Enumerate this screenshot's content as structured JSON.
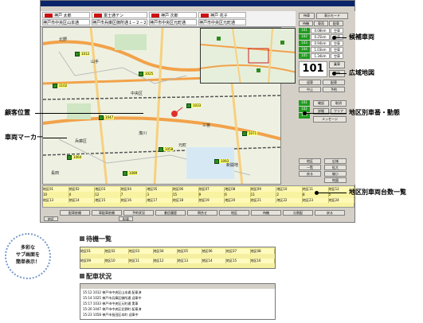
{
  "main_window": {
    "title_bar": "",
    "header": {
      "r1c1": "神戸 太郎",
      "r1c2": "富士通テン",
      "r1c3": "神戸 次郎",
      "r1c4": "神戸 花子",
      "r2c1": "神戸市中央区山本通",
      "r2c2": "神戸市兵庫区御所通１−２−２８",
      "r2c3": "神戸市中央区元町通",
      "r2c4": "神戸市中央区元町通"
    },
    "map_labels": [
      "北野",
      "中央区",
      "兵庫区",
      "湊川",
      "三宮",
      "元町",
      "長田",
      "新開地",
      "山手"
    ],
    "vehicle_labels": [
      "1012",
      "1025",
      "1033",
      "1047",
      "1058",
      "1064",
      "1071",
      "1089",
      "1093",
      "1102"
    ],
    "right_panel": {
      "top_buttons": [
        "待車",
        "表示モード"
      ],
      "tabs": [
        "待機",
        "車両",
        "配車"
      ],
      "rows": [
        {
          "no": "101",
          "time": "0.08km",
          "st": "空車"
        },
        {
          "no": "102",
          "time": "0.25km",
          "st": "空車"
        },
        {
          "no": "103",
          "time": "0.94km",
          "st": "空車"
        },
        {
          "no": "104",
          "time": "1.03km",
          "st": "空車"
        },
        {
          "no": "105",
          "time": "1.34km",
          "st": "空車"
        }
      ],
      "big_number": "101",
      "side_labels": [
        "乗車",
        "中央"
      ],
      "buttons": [
        "迎車",
        "配車",
        "中止",
        "予約",
        "確認",
        "取消",
        "詳細",
        "クリア",
        "メッセージ"
      ],
      "area_cars": [
        "101",
        "102",
        "103"
      ],
      "lower_buttons": [
        "広域",
        "拡大",
        "縮小",
        "地図",
        "他区",
        "一覧",
        "戻る"
      ]
    },
    "area_table": {
      "row1": [
        "地区01",
        "地区02",
        "地区03",
        "地区04",
        "地区05",
        "地区06",
        "地区07",
        "地区08",
        "地区09",
        "地区10",
        "地区11",
        "地区12"
      ],
      "row2": [
        "10",
        "4",
        "12",
        "7",
        "3",
        "15",
        "9",
        "6",
        "11",
        "2",
        "8",
        "5"
      ],
      "row3": [
        "地区13",
        "地区14",
        "地区15",
        "地区16",
        "地区17",
        "地区18",
        "地区19",
        "地区20",
        "地区21",
        "地区22",
        "地区23",
        "地区24"
      ]
    },
    "bottom_buttons": [
      "配車依頼",
      "車配車依頼",
      "予約状況",
      "着信履歴",
      "問合せ",
      "地区",
      "待機",
      "分割配",
      "戻る"
    ],
    "bottom_small": [
      "地区",
      "配車"
    ]
  },
  "callouts": {
    "candidate": "候補車両",
    "wide_map": "広域地図",
    "customer": "顧客位置",
    "area_vehicles": "地区別車番・動態",
    "vehicle_marker": "車両マーカー",
    "area_counts": "地区別車両台数一覧"
  },
  "bubble": {
    "line1": "多彩な",
    "line2": "サブ画面を",
    "line3": "簡単表示！"
  },
  "wait_section": {
    "title": "待機一覧",
    "row1": [
      "地区01",
      "地区02",
      "地区03",
      "地区04",
      "地区05",
      "地区06",
      "地区07",
      "地区08"
    ],
    "row2": [
      "地区09",
      "地区10",
      "地区11",
      "地区12",
      "地区13",
      "地区14",
      "地区15",
      "地区16"
    ]
  },
  "dispatch_section": {
    "title": "配車状況",
    "rows": [
      "15:12  1012  神戸市中央区山本通  配車済",
      "15:14  1025  神戸市兵庫区御所通  迎車中",
      "15:17  1033  神戸市中央区元町通  実車",
      "15:20  1047  神戸市中央区北野町  配車済",
      "15:23  1058  神戸市長田区本町    迎車中"
    ]
  }
}
